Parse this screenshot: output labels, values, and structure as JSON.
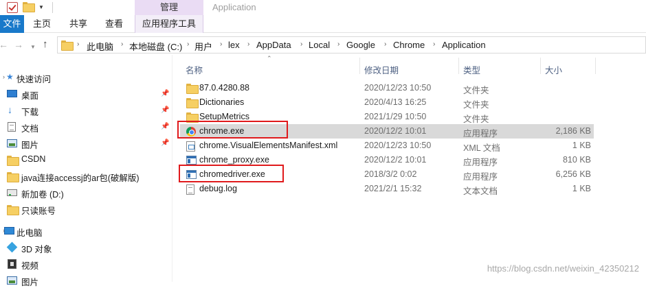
{
  "title_bar": {
    "context_tab": "管理",
    "window_title": "Application"
  },
  "ribbon": {
    "file": "文件",
    "home": "主页",
    "share": "共享",
    "view": "查看",
    "app_tools": "应用程序工具"
  },
  "address_bar": {
    "crumbs": [
      "此电脑",
      "本地磁盘 (C:)",
      "用户",
      "lex",
      "AppData",
      "Local",
      "Google",
      "Chrome",
      "Application"
    ]
  },
  "nav_pane": {
    "items": [
      {
        "label": "快速访问",
        "icon": "star-icon"
      },
      {
        "label": "桌面",
        "icon": "desktop-icon",
        "pinned": true
      },
      {
        "label": "下载",
        "icon": "download-icon",
        "pinned": true
      },
      {
        "label": "文档",
        "icon": "document-icon",
        "pinned": true
      },
      {
        "label": "图片",
        "icon": "pictures-icon",
        "pinned": true
      },
      {
        "label": "CSDN",
        "icon": "folder-icon"
      },
      {
        "label": "java连接accessj的ar包(破解版)",
        "icon": "folder-icon"
      },
      {
        "label": "新加卷 (D:)",
        "icon": "drive-icon"
      },
      {
        "label": "只读账号",
        "icon": "folder-icon"
      },
      {
        "label": "此电脑",
        "icon": "computer-icon"
      },
      {
        "label": "3D 对象",
        "icon": "3d-objects-icon"
      },
      {
        "label": "视频",
        "icon": "video-icon"
      },
      {
        "label": "图片",
        "icon": "pictures-icon"
      }
    ]
  },
  "columns": {
    "name": "名称",
    "modified": "修改日期",
    "type": "类型",
    "size": "大小"
  },
  "files": [
    {
      "name": "87.0.4280.88",
      "modified": "2020/12/23 10:50",
      "type": "文件夹",
      "size": "",
      "icon": "folder-icon"
    },
    {
      "name": "Dictionaries",
      "modified": "2020/4/13 16:25",
      "type": "文件夹",
      "size": "",
      "icon": "folder-icon"
    },
    {
      "name": "SetupMetrics",
      "modified": "2021/1/29 10:50",
      "type": "文件夹",
      "size": "",
      "icon": "folder-icon"
    },
    {
      "name": "chrome.exe",
      "modified": "2020/12/2 10:01",
      "type": "应用程序",
      "size": "2,186 KB",
      "icon": "chrome-icon",
      "selected": true,
      "highlighted": true
    },
    {
      "name": "chrome.VisualElementsManifest.xml",
      "modified": "2020/12/23 10:50",
      "type": "XML 文档",
      "size": "1 KB",
      "icon": "xml-file-icon"
    },
    {
      "name": "chrome_proxy.exe",
      "modified": "2020/12/2 10:01",
      "type": "应用程序",
      "size": "810 KB",
      "icon": "exe-icon"
    },
    {
      "name": "chromedriver.exe",
      "modified": "2018/3/2 0:02",
      "type": "应用程序",
      "size": "6,256 KB",
      "icon": "exe-icon",
      "highlighted": true
    },
    {
      "name": "debug.log",
      "modified": "2021/2/1 15:32",
      "type": "文本文档",
      "size": "1 KB",
      "icon": "text-file-icon"
    }
  ],
  "watermark": "https://blog.csdn.net/weixin_42350212",
  "colors": {
    "file_tab": "#1979ca",
    "context_tab": "#eadcf4",
    "highlight_box": "#e0191b",
    "selected_row": "#d9d9d9",
    "column_header_text": "#4d6082"
  }
}
